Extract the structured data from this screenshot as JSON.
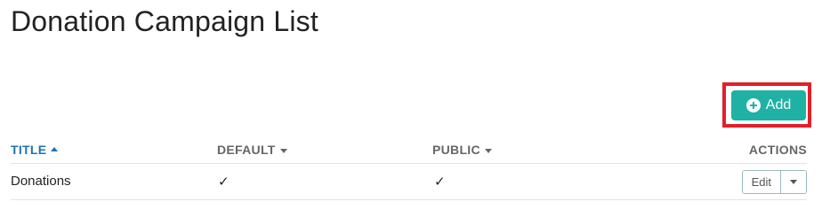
{
  "page": {
    "title": "Donation Campaign List"
  },
  "toolbar": {
    "add_label": "Add"
  },
  "table": {
    "columns": [
      {
        "label": "TITLE",
        "sort": "asc"
      },
      {
        "label": "DEFAULT",
        "sort": "none"
      },
      {
        "label": "PUBLIC",
        "sort": "none"
      },
      {
        "label": "ACTIONS"
      }
    ],
    "rows": [
      {
        "title": "Donations",
        "default": "✓",
        "public": "✓",
        "edit_label": "Edit"
      }
    ]
  },
  "colors": {
    "accent": "#1fb1a4",
    "sorted_header": "#1c74b5",
    "highlight": "#e0202a"
  }
}
